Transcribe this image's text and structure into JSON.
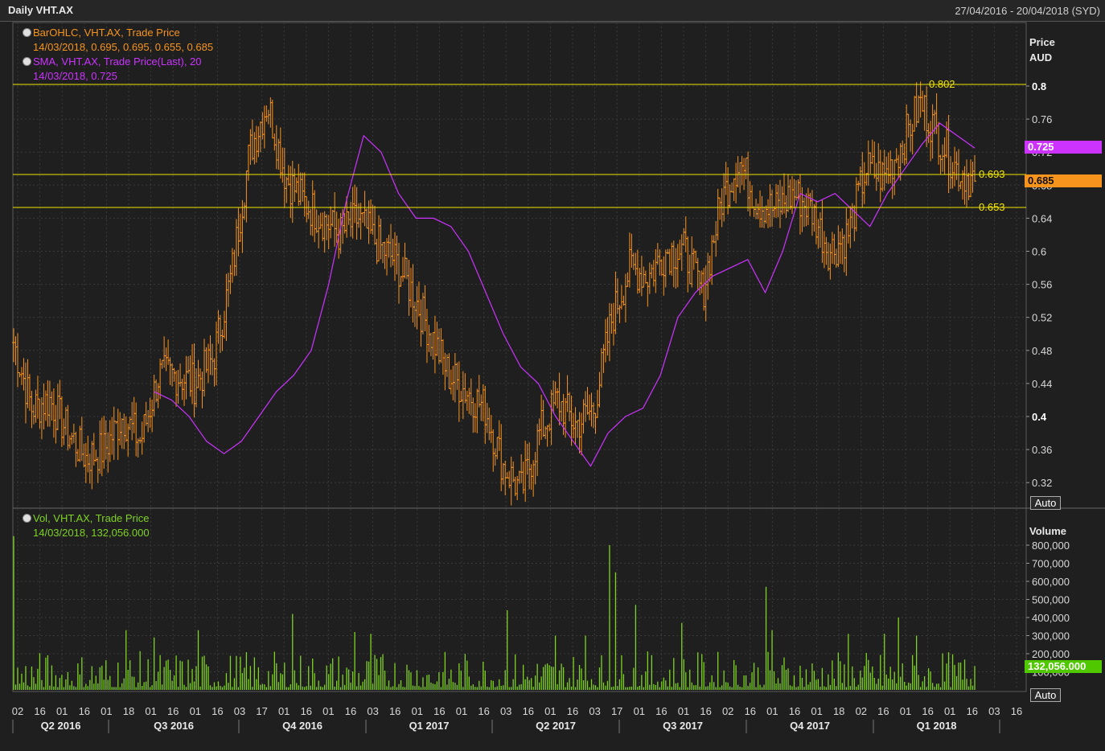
{
  "window": {
    "title": "Daily VHT.AX",
    "date_range": "27/04/2016 - 20/04/2018 (SYD)",
    "auto_label": "Auto"
  },
  "colors": {
    "price": "#f7941d",
    "sma": "#cc33ff",
    "volume": "#7ed321",
    "level": "#f2e600",
    "grid": "#3a3a3a",
    "background": "#1f1f1f"
  },
  "legend": {
    "price_line1": "BarOHLC, VHT.AX, Trade Price",
    "price_line2": "14/03/2018, 0.695, 0.695, 0.655, 0.685",
    "sma_line1": "SMA, VHT.AX, Trade Price(Last),  20",
    "sma_line2": "14/03/2018, 0.725",
    "vol_line1": "Vol, VHT.AX, Trade Price",
    "vol_line2": "14/03/2018, 132,056.000"
  },
  "tags": {
    "sma_last": "0.725",
    "price_last": "0.685",
    "volume_last": "132,056.000"
  },
  "chart_data": [
    {
      "type": "ohlc",
      "yaxis_title_1": "Price",
      "yaxis_title_2": "AUD",
      "ylim": [
        0.29,
        0.84
      ],
      "yticks": [
        0.32,
        0.36,
        0.4,
        0.44,
        0.48,
        0.52,
        0.56,
        0.6,
        0.64,
        0.68,
        0.72,
        0.76,
        0.8
      ],
      "ytick_labels": [
        "0.32",
        "0.36",
        "0.4",
        "0.44",
        "0.48",
        "0.52",
        "0.56",
        "0.6",
        "0.64",
        "0.68",
        "0.72",
        "0.76",
        "0.8"
      ],
      "grid": true,
      "horizontal_levels": [
        {
          "value": 0.802,
          "label": "0.802"
        },
        {
          "value": 0.693,
          "label": "0.693"
        },
        {
          "value": 0.653,
          "label": "0.653"
        }
      ],
      "price_close_anchors": [
        0.49,
        0.41,
        0.42,
        0.38,
        0.35,
        0.36,
        0.4,
        0.37,
        0.45,
        0.45,
        0.44,
        0.47,
        0.57,
        0.72,
        0.78,
        0.69,
        0.66,
        0.64,
        0.62,
        0.64,
        0.61,
        0.59,
        0.55,
        0.5,
        0.45,
        0.43,
        0.41,
        0.34,
        0.31,
        0.38,
        0.42,
        0.39,
        0.41,
        0.52,
        0.58,
        0.57,
        0.6,
        0.6,
        0.55,
        0.66,
        0.71,
        0.66,
        0.65,
        0.67,
        0.65,
        0.6,
        0.62,
        0.7,
        0.69,
        0.73,
        0.78,
        0.74,
        0.7,
        0.685
      ],
      "sma": {
        "name": "SMA, VHT.AX, Trade Price(Last),  20",
        "values": [
          0.43,
          0.42,
          0.4,
          0.37,
          0.355,
          0.37,
          0.4,
          0.43,
          0.45,
          0.48,
          0.56,
          0.66,
          0.74,
          0.72,
          0.67,
          0.64,
          0.64,
          0.63,
          0.6,
          0.55,
          0.5,
          0.46,
          0.44,
          0.4,
          0.37,
          0.34,
          0.38,
          0.4,
          0.41,
          0.45,
          0.52,
          0.55,
          0.57,
          0.58,
          0.59,
          0.55,
          0.6,
          0.67,
          0.66,
          0.67,
          0.65,
          0.63,
          0.67,
          0.7,
          0.73,
          0.755,
          0.74,
          0.725
        ],
        "last": 0.725
      }
    },
    {
      "type": "bar",
      "yaxis_title": "Volume",
      "ylim": [
        0,
        850000
      ],
      "yticks": [
        100000,
        200000,
        300000,
        400000,
        500000,
        600000,
        700000,
        800000
      ],
      "ytick_labels": [
        "100,000",
        "200,000",
        "300,000",
        "400,000",
        "500,000",
        "600,000",
        "700,000",
        "800,000"
      ],
      "grid": true,
      "spikes": [
        {
          "day": 0,
          "value": 850000
        },
        {
          "day": 56,
          "value": 330000
        },
        {
          "day": 70,
          "value": 290000
        },
        {
          "day": 92,
          "value": 330000
        },
        {
          "day": 139,
          "value": 420000
        },
        {
          "day": 170,
          "value": 320000
        },
        {
          "day": 178,
          "value": 310000
        },
        {
          "day": 246,
          "value": 440000
        },
        {
          "day": 270,
          "value": 300000
        },
        {
          "day": 285,
          "value": 300000
        },
        {
          "day": 297,
          "value": 800000
        },
        {
          "day": 300,
          "value": 650000
        },
        {
          "day": 310,
          "value": 470000
        },
        {
          "day": 333,
          "value": 370000
        },
        {
          "day": 375,
          "value": 570000
        },
        {
          "day": 378,
          "value": 330000
        },
        {
          "day": 416,
          "value": 310000
        },
        {
          "day": 434,
          "value": 310000
        },
        {
          "day": 441,
          "value": 400000
        },
        {
          "day": 450,
          "value": 300000
        }
      ],
      "last_value": 132056
    }
  ],
  "x_axis": {
    "day_labels": [
      "02",
      "16",
      "01",
      "16",
      "01",
      "18",
      "01",
      "16",
      "01",
      "16",
      "03",
      "17",
      "01",
      "16",
      "01",
      "16",
      "03",
      "16",
      "01",
      "16",
      "01",
      "16",
      "03",
      "16",
      "01",
      "16",
      "03",
      "17",
      "01",
      "16",
      "01",
      "16",
      "02",
      "16",
      "01",
      "16",
      "01",
      "18",
      "02",
      "16",
      "01",
      "16",
      "01",
      "16",
      "03",
      "16"
    ],
    "quarter_labels": [
      "Q2 2016",
      "Q3 2016",
      "Q4 2016",
      "Q1 2017",
      "Q2 2017",
      "Q3 2017",
      "Q4 2017",
      "Q1 2018"
    ]
  }
}
